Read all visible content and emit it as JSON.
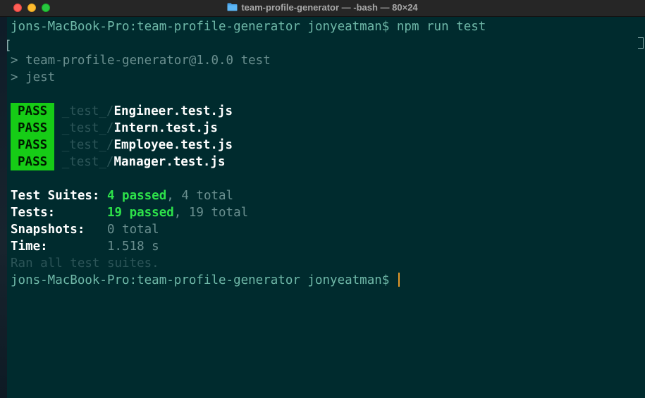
{
  "window": {
    "title": "team-profile-generator — -bash — 80×24"
  },
  "terminal": {
    "command_prompt": "jons-MacBook-Pro:team-profile-generator jonyeatman$ ",
    "command": "npm run test",
    "script_line_1": "> team-profile-generator@1.0.0 test",
    "script_line_2": "> jest",
    "tests": [
      {
        "badge": "PASS",
        "dir": "_test_/",
        "file": "Engineer.test.js"
      },
      {
        "badge": "PASS",
        "dir": "_test_/",
        "file": "Intern.test.js"
      },
      {
        "badge": "PASS",
        "dir": "_test_/",
        "file": "Employee.test.js"
      },
      {
        "badge": "PASS",
        "dir": "_test_/",
        "file": "Manager.test.js"
      }
    ],
    "summary": {
      "suites_label": "Test Suites: ",
      "suites_passed": "4 passed",
      "suites_total": ", 4 total",
      "tests_label": "Tests:       ",
      "tests_passed": "19 passed",
      "tests_total": ", 19 total",
      "snapshots_label": "Snapshots:   ",
      "snapshots_value": "0 total",
      "time_label": "Time:        ",
      "time_value": "1.518 s"
    },
    "ran_all": "Ran all test suites.",
    "final_prompt": "jons-MacBook-Pro:team-profile-generator jonyeatman$ "
  },
  "colors": {
    "background": "#002b2e",
    "pass_badge": "#16cc16",
    "passed_text": "#2de24a",
    "cursor": "#e69a2a"
  }
}
